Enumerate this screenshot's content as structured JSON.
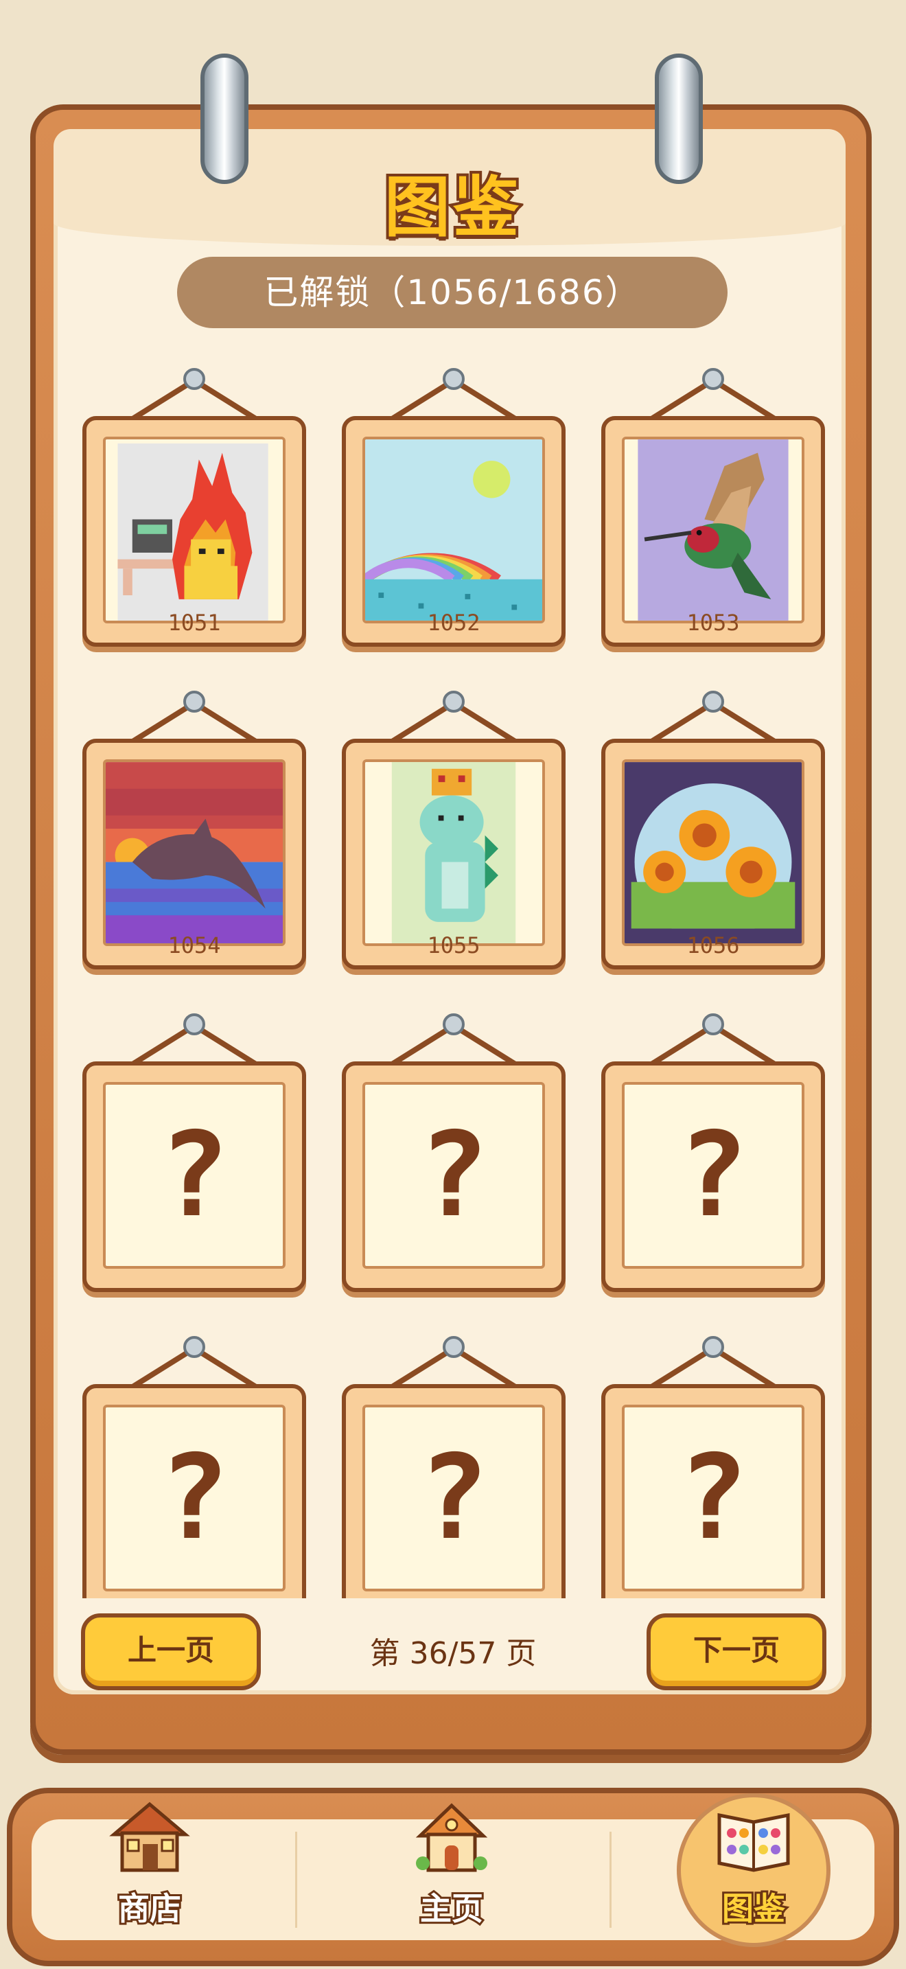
{
  "header": {
    "title": "图鉴",
    "unlocked_text": "已解锁（1056/1686）"
  },
  "grid": {
    "items": [
      {
        "number": "1051",
        "unlocked": true,
        "art": "fire-cat-icon"
      },
      {
        "number": "1052",
        "unlocked": true,
        "art": "rainbow-icon"
      },
      {
        "number": "1053",
        "unlocked": true,
        "art": "hummingbird-icon"
      },
      {
        "number": "1054",
        "unlocked": true,
        "art": "dolphin-icon"
      },
      {
        "number": "1055",
        "unlocked": true,
        "art": "dinosaur-icon"
      },
      {
        "number": "1056",
        "unlocked": true,
        "art": "sunflowers-icon"
      },
      {
        "unlocked": false,
        "placeholder": "?"
      },
      {
        "unlocked": false,
        "placeholder": "?"
      },
      {
        "unlocked": false,
        "placeholder": "?"
      },
      {
        "unlocked": false,
        "placeholder": "?"
      },
      {
        "unlocked": false,
        "placeholder": "?"
      },
      {
        "unlocked": false,
        "placeholder": "?"
      }
    ]
  },
  "pagination": {
    "prev_label": "上一页",
    "page_text": "第 36/57 页",
    "next_label": "下一页"
  },
  "nav": {
    "items": [
      {
        "label": "商店",
        "icon": "shop-house-icon",
        "active": false
      },
      {
        "label": "主页",
        "icon": "home-cottage-icon",
        "active": false
      },
      {
        "label": "图鉴",
        "icon": "flower-book-icon",
        "active": true
      }
    ]
  },
  "colors": {
    "board": "#c7773c",
    "paper": "#fbf1de",
    "accent_yellow": "#ffcb3a",
    "text_brown": "#6b3413"
  }
}
